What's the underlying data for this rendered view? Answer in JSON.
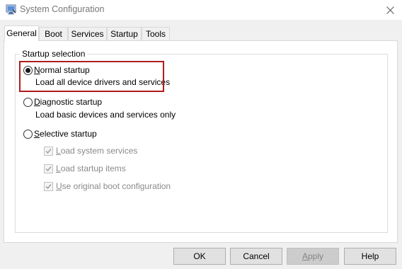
{
  "window": {
    "title": "System Configuration"
  },
  "tabs": [
    {
      "label": "General",
      "active": true
    },
    {
      "label": "Boot",
      "active": false
    },
    {
      "label": "Services",
      "active": false
    },
    {
      "label": "Startup",
      "active": false
    },
    {
      "label": "Tools",
      "active": false
    }
  ],
  "startup_selection": {
    "legend": "Startup selection",
    "normal": {
      "underline_char": "N",
      "rest": "ormal startup",
      "description": "Load all device drivers and services",
      "checked": true
    },
    "diagnostic": {
      "underline_char": "D",
      "rest": "iagnostic startup",
      "description": "Load basic devices and services only",
      "checked": false
    },
    "selective": {
      "underline_char": "S",
      "rest": "elective startup",
      "checked": false,
      "options": [
        {
          "underline_char": "L",
          "rest": "oad system services",
          "checked": true,
          "enabled": false
        },
        {
          "underline_char": "L",
          "rest": "oad startup items",
          "checked": true,
          "enabled": false
        },
        {
          "underline_char": "U",
          "rest": "se original boot configuration",
          "checked": true,
          "enabled": false
        }
      ]
    }
  },
  "buttons": {
    "ok": "OK",
    "cancel": "Cancel",
    "apply": {
      "underline_char": "A",
      "rest": "pply",
      "enabled": false
    },
    "help": "Help"
  },
  "colors": {
    "highlight": "#b01c1c",
    "disabled_text": "#8a8a8a"
  }
}
